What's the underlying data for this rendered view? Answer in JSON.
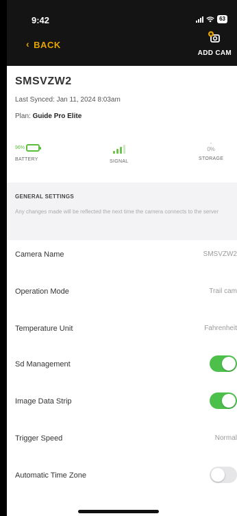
{
  "status_bar": {
    "time": "9:42",
    "battery": "63"
  },
  "header": {
    "back_label": "BACK",
    "add_cam_label": "ADD CAM",
    "accent_color": "#e5a400"
  },
  "camera": {
    "name": "SMSVZW2",
    "last_synced": "Last Synced: Jan 11, 2024 8:03am",
    "plan_prefix": "Plan:",
    "plan_name": "Guide Pro Elite"
  },
  "stats": {
    "battery": {
      "label": "BATTERY",
      "percent_text": "96%",
      "fill_fraction": 0.96,
      "color": "#5bbd3c"
    },
    "signal": {
      "label": "SIGNAL",
      "bars_active": 3,
      "bars_total": 4
    },
    "storage": {
      "label": "STORAGE",
      "value": "0%"
    }
  },
  "general_settings": {
    "title": "GENERAL SETTINGS",
    "note": "Any changes made will be reflected the next time the camera connects to the server"
  },
  "settings": [
    {
      "label": "Camera Name",
      "value": "SMSVZW2"
    },
    {
      "label": "Operation Mode",
      "value": "Trail cam"
    },
    {
      "label": "Temperature Unit",
      "value": "Fahrenheit"
    },
    {
      "label": "Sd Management",
      "toggle": true
    },
    {
      "label": "Image Data Strip",
      "toggle": true
    },
    {
      "label": "Trigger Speed",
      "value": "Normal"
    },
    {
      "label": "Automatic Time Zone",
      "toggle": false
    }
  ],
  "colors": {
    "toggle_on": "#4cc04a",
    "toggle_off": "#e6e6e8",
    "header_bg": "#141414"
  }
}
